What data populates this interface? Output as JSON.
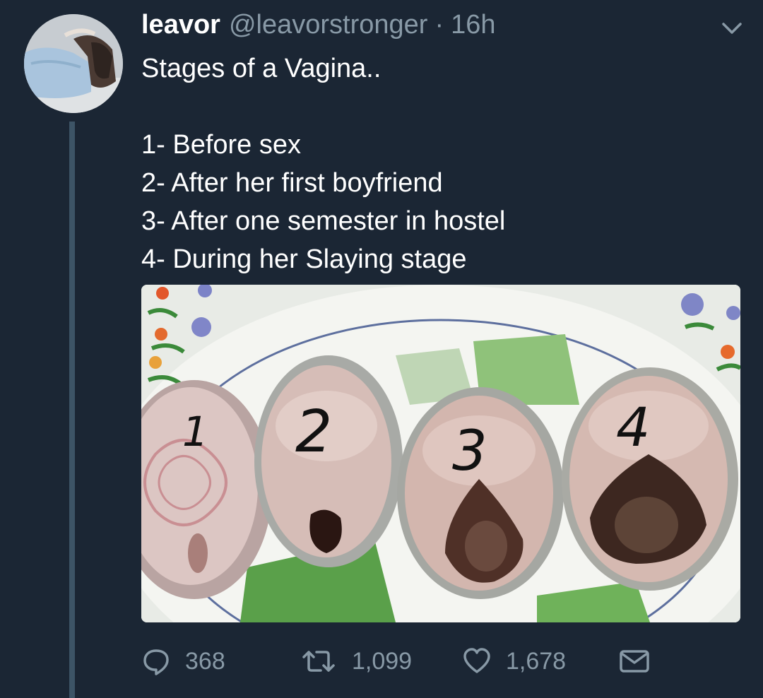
{
  "user": {
    "display_name": "leavor",
    "handle": "@leavorstronger",
    "separator": "·",
    "time": "16h"
  },
  "tweet": {
    "lines": [
      "Stages of a Vagina..",
      "",
      "1- Before sex",
      "2- After her first boyfriend",
      "3- After one semester in hostel",
      "4- During her Slaying stage"
    ]
  },
  "media": {
    "numbers": [
      "1",
      "2",
      "3",
      "4"
    ]
  },
  "actions": {
    "reply": {
      "icon": "reply-icon",
      "count": "368"
    },
    "retweet": {
      "icon": "retweet-icon",
      "count": "1,099"
    },
    "like": {
      "icon": "heart-icon",
      "count": "1,678"
    },
    "dm": {
      "icon": "envelope-icon"
    }
  },
  "colors": {
    "background": "#1b2634",
    "secondary_text": "#8899a6",
    "thread_line": "#3d5466"
  }
}
